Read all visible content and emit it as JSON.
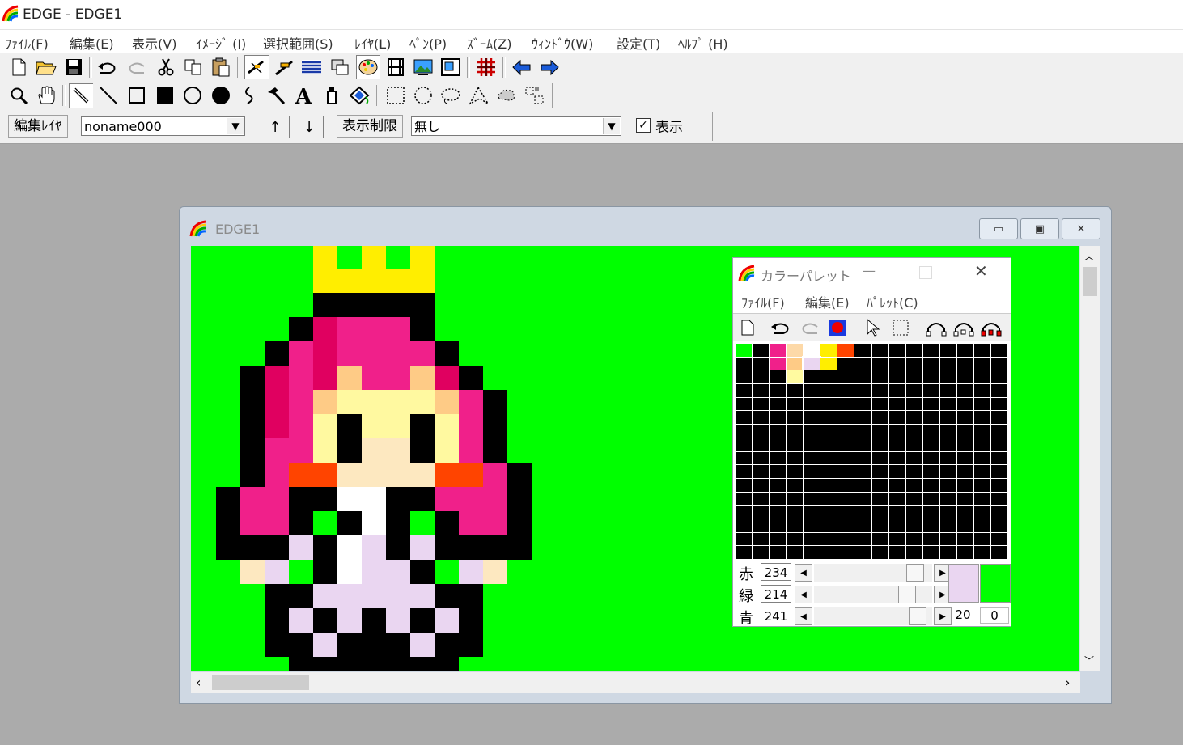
{
  "window": {
    "title": "EDGE - EDGE1"
  },
  "menu": [
    "ﾌｧｲﾙ(F)",
    "編集(E)",
    "表示(V)",
    "ｲﾒｰｼﾞ (I)",
    "選択範囲(S)",
    "ﾚｲﾔ(L)",
    "ﾍﾟﾝ(P)",
    "ｽﾞｰﾑ(Z)",
    "ｳｨﾝﾄﾞｳ(W)",
    "設定(T)",
    "ﾍﾙﾌﾟ (H)"
  ],
  "layerbar": {
    "edit_layer_label": "編集ﾚｲﾔ",
    "layer_value": "noname000",
    "up_label": "↑",
    "down_label": "↓",
    "display_limit_label": "表示制限",
    "display_limit_value": "無し",
    "show_checkbox_label": "表示",
    "show_checked": true
  },
  "child": {
    "title": "EDGE1"
  },
  "palette": {
    "title": "カラーパレット",
    "menu": [
      "ﾌｧｲﾙ(F)",
      "編集(E)",
      "ﾊﾟﾚｯﾄ(C)"
    ],
    "sliders": [
      {
        "label": "赤",
        "value": "234",
        "level": 234
      },
      {
        "label": "緑",
        "value": "214",
        "level": 214
      },
      {
        "label": "青",
        "value": "241",
        "level": 241
      }
    ],
    "current_color": "#eAD6F1",
    "back_color": "#00ff00",
    "index_label": "20",
    "index_label2": "0",
    "swatches": {
      "0": "#00ff00",
      "2": "#f0208a",
      "3": "#fdd9a8",
      "4": "#ffffff",
      "5": "#ffee00",
      "6": "#ff4400",
      "18": "#f0208a",
      "19": "#fecb86",
      "20": "#ead6f1",
      "21": "#ffee00",
      "35": "#fffaa0"
    }
  },
  "colors": {
    "canvas_bg": "#00ff00",
    "black": "#000000",
    "crown": "#ffee00",
    "hair": "#f0208a",
    "hair_dark": "#e00060",
    "skin": "#fff9a0",
    "skin_shade": "#fecb86",
    "face": "#fde8c0",
    "cheek": "#ff4400",
    "dress": "#ead6f1",
    "white": "#ffffff",
    "hand": "#fde8c0"
  }
}
